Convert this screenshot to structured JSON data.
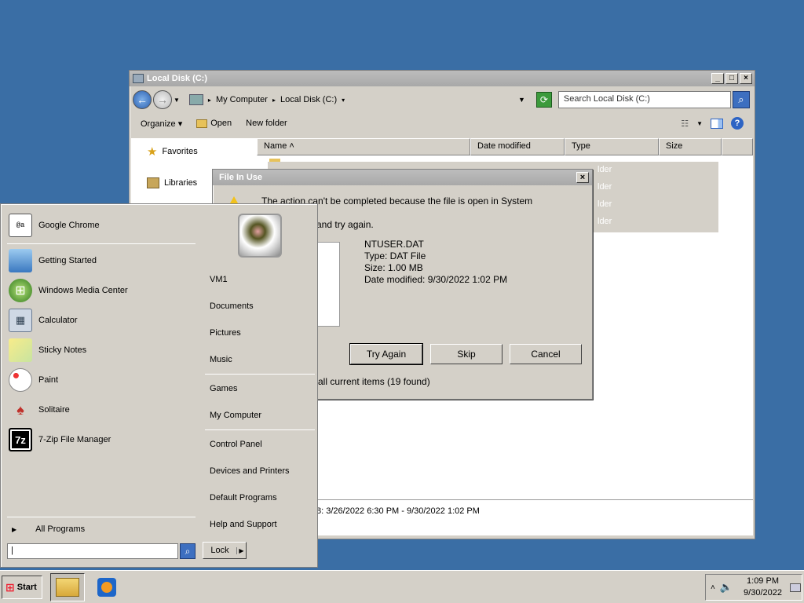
{
  "explorer": {
    "title": "Local Disk (C:)",
    "breadcrumb": [
      "My Computer",
      "Local Disk (C:)"
    ],
    "search_placeholder": "Search Local Disk (C:)",
    "commands": {
      "organize": "Organize",
      "open": "Open",
      "new_folder": "New folder"
    },
    "nav": {
      "favorites": "Favorites",
      "libraries": "Libraries"
    },
    "columns": [
      "Name",
      "Date modified",
      "Type",
      "Size"
    ],
    "visible_type_fragments": [
      "lder",
      "lder",
      "lder",
      "lder"
    ],
    "details_text": "3/26/2022 6:30 PM - 9/30/2022 1:02 PM"
  },
  "dialog": {
    "title": "File In Use",
    "message_line1": "The action can't be completed because the file is open in System",
    "message_line2": "and try again.",
    "file": {
      "name": "NTUSER.DAT",
      "type": "Type: DAT File",
      "size": "Size: 1.00 MB",
      "modified": "Date modified: 9/30/2022 1:02 PM"
    },
    "buttons": {
      "try_again": "Try Again",
      "skip": "Skip",
      "cancel": "Cancel"
    },
    "apply_all_fragment": "all current items (19 found)"
  },
  "start_menu": {
    "pinned": "Google Chrome",
    "recent": [
      "Getting Started",
      "Windows Media Center",
      "Calculator",
      "Sticky Notes",
      "Paint",
      "Solitaire",
      "7-Zip File Manager"
    ],
    "all_programs": "All Programs",
    "right": {
      "user": "VM1",
      "group1": [
        "Documents",
        "Pictures",
        "Music"
      ],
      "group2": [
        "Games",
        "My Computer"
      ],
      "group3": [
        "Control Panel",
        "Devices and Printers",
        "Default Programs",
        "Help and Support"
      ]
    },
    "search_value": "|",
    "lock_label": "Lock"
  },
  "taskbar": {
    "start_label": "Start",
    "time": "1:09 PM",
    "date": "9/30/2022"
  },
  "icons": {
    "7zip_text": "7z",
    "chrome_label_box": "@a"
  }
}
